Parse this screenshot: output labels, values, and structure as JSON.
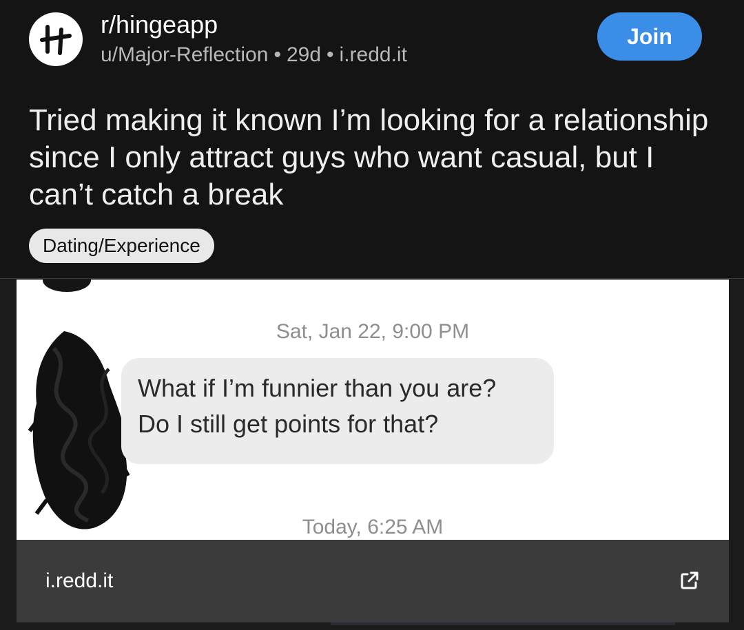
{
  "subreddit": {
    "name": "r/hingeapp",
    "avatar_letter": "H"
  },
  "meta": {
    "user": "u/Major-Reflection",
    "separator": "•",
    "age": "29d",
    "domain": "i.redd.it"
  },
  "join_button": {
    "label": "Join",
    "color": "#3a8ee8"
  },
  "post": {
    "title": "Tried making it known I’m looking for a relationship since I only attract guys who want casual, but I can’t catch a break",
    "flair": "Dating/Experience"
  },
  "screenshot": {
    "top_timestamp": "Sat, Jan 22, 9:00 PM",
    "message_line_1": "What if I’m funnier than you are?",
    "message_line_2": "Do I still get points for that?",
    "bottom_timestamp": "Today, 6:25 AM"
  },
  "link_bar": {
    "domain": "i.redd.it",
    "icon": "external-link-icon"
  }
}
